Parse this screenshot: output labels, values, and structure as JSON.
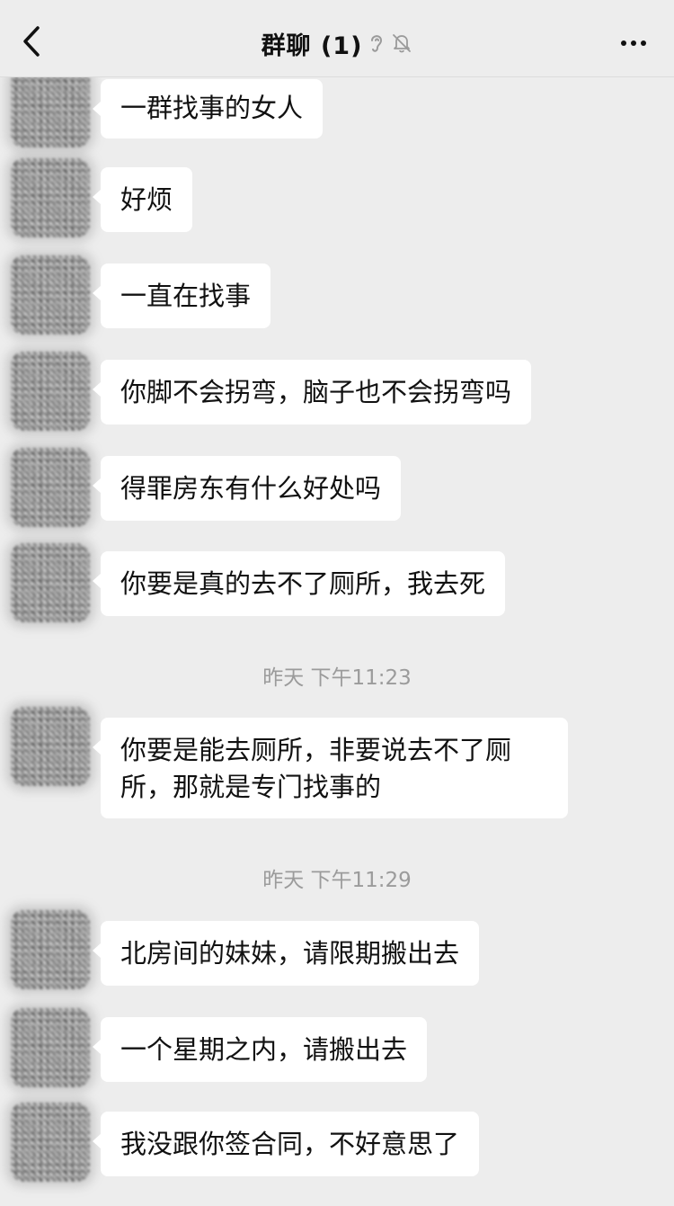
{
  "header": {
    "title": "群聊 (1)",
    "icons": [
      "ear-icon",
      "bell-muted-icon"
    ],
    "back_icon": "chevron-left-icon",
    "more_icon": "more-dots-icon"
  },
  "messages": [
    {
      "type": "text",
      "text": "一群找事的女人"
    },
    {
      "type": "text",
      "text": "好烦"
    },
    {
      "type": "text",
      "text": "一直在找事"
    },
    {
      "type": "text",
      "text": "你脚不会拐弯，脑子也不会拐弯吗"
    },
    {
      "type": "text",
      "text": "得罪房东有什么好处吗"
    },
    {
      "type": "text",
      "text": "你要是真的去不了厕所，我去死"
    },
    {
      "type": "timestamp",
      "text": "昨天 下午11:23"
    },
    {
      "type": "text",
      "text": "你要是能去厕所，非要说去不了厕所，那就是专门找事的"
    },
    {
      "type": "timestamp",
      "text": "昨天 下午11:29"
    },
    {
      "type": "text",
      "text": "北房间的妹妹，请限期搬出去"
    },
    {
      "type": "text",
      "text": "一个星期之内，请搬出去"
    },
    {
      "type": "text",
      "text": "我没跟你签合同，不好意思了"
    }
  ],
  "colors": {
    "background": "#ededed",
    "bubble": "#ffffff",
    "timestamp": "#9b9b9b",
    "text": "#111111"
  }
}
